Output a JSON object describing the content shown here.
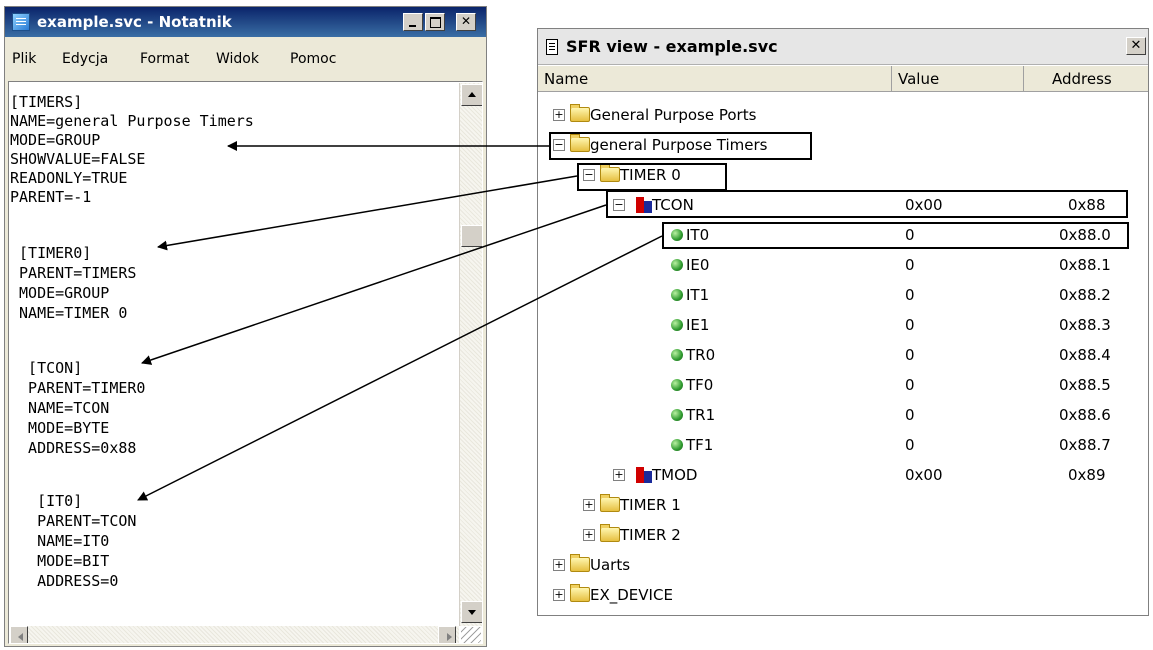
{
  "notepad": {
    "title": "example.svc - Notatnik",
    "menu": [
      "Plik",
      "Edycja",
      "Format",
      "Widok",
      "Pomoc"
    ],
    "lines": [
      "[TIMERS]",
      "NAME=general Purpose Timers",
      "MODE=GROUP",
      "SHOWVALUE=FALSE",
      "READONLY=TRUE",
      "PARENT=-1",
      " [TIMER0]",
      " PARENT=TIMERS",
      " MODE=GROUP",
      " NAME=TIMER 0",
      "  [TCON]",
      "  PARENT=TIMER0",
      "  NAME=TCON",
      "  MODE=BYTE",
      "  ADDRESS=0x88",
      "   [IT0]",
      "   PARENT=TCON",
      "   NAME=IT0",
      "   MODE=BIT",
      "   ADDRESS=0"
    ]
  },
  "sfr": {
    "title": "SFR view - example.svc",
    "columns": {
      "name": "Name",
      "value": "Value",
      "address": "Address"
    },
    "rows": [
      {
        "label": "General Purpose Ports",
        "icon": "folder-icon",
        "expander": "+",
        "value": "",
        "address": ""
      },
      {
        "label": "general Purpose Timers",
        "icon": "folder-icon",
        "expander": "−",
        "value": "",
        "address": ""
      },
      {
        "label": "TIMER 0",
        "icon": "folder-icon",
        "expander": "−",
        "value": "",
        "address": ""
      },
      {
        "label": "TCON",
        "icon": "byte-register-icon",
        "expander": "−",
        "value": "0x00",
        "address": "0x88"
      },
      {
        "label": "IT0",
        "icon": "bit-icon",
        "expander": "",
        "value": "0",
        "address": "0x88.0"
      },
      {
        "label": "IE0",
        "icon": "bit-icon",
        "expander": "",
        "value": "0",
        "address": "0x88.1"
      },
      {
        "label": "IT1",
        "icon": "bit-icon",
        "expander": "",
        "value": "0",
        "address": "0x88.2"
      },
      {
        "label": "IE1",
        "icon": "bit-icon",
        "expander": "",
        "value": "0",
        "address": "0x88.3"
      },
      {
        "label": "TR0",
        "icon": "bit-icon",
        "expander": "",
        "value": "0",
        "address": "0x88.4"
      },
      {
        "label": "TF0",
        "icon": "bit-icon",
        "expander": "",
        "value": "0",
        "address": "0x88.5"
      },
      {
        "label": "TR1",
        "icon": "bit-icon",
        "expander": "",
        "value": "0",
        "address": "0x88.6"
      },
      {
        "label": "TF1",
        "icon": "bit-icon",
        "expander": "",
        "value": "0",
        "address": "0x88.7"
      },
      {
        "label": "TMOD",
        "icon": "byte-register-icon",
        "expander": "+",
        "value": "0x00",
        "address": "0x89"
      },
      {
        "label": "TIMER 1",
        "icon": "folder-icon",
        "expander": "+",
        "value": "",
        "address": ""
      },
      {
        "label": "TIMER 2",
        "icon": "folder-icon",
        "expander": "+",
        "value": "",
        "address": ""
      },
      {
        "label": "Uarts",
        "icon": "folder-icon",
        "expander": "+",
        "value": "",
        "address": ""
      },
      {
        "label": "EX_DEVICE",
        "icon": "folder-icon",
        "expander": "+",
        "value": "",
        "address": ""
      }
    ]
  },
  "colors": {
    "notepad_titlebar": "#0a246a",
    "window_face": "#ece9d8",
    "highlight_border": "#000000",
    "arrow": "#000000"
  }
}
